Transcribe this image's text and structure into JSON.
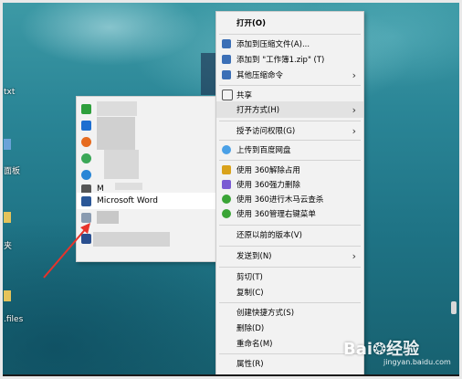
{
  "desktop": {
    "edge_labels": [
      "txt",
      "面板",
      "夹",
      ".files"
    ]
  },
  "submenu": {
    "items": [
      {
        "label": "",
        "icon": "edge-icon",
        "color": "#2e9f3c"
      },
      {
        "label": "",
        "icon": "app-icon",
        "color": "#1e6fd0"
      },
      {
        "label": "",
        "icon": "firefox-icon",
        "color": "#e66b1f"
      },
      {
        "label": "",
        "icon": "chrome-icon",
        "color": "#3aa757"
      },
      {
        "label": "",
        "icon": "ie-icon",
        "color": "#2a86d6"
      },
      {
        "label": "M",
        "icon": "app-icon",
        "color": "#555555"
      },
      {
        "label": "Microsoft Word",
        "icon": "word-icon",
        "color": "#2b5797"
      },
      {
        "label": "",
        "icon": "app-icon",
        "color": "#8a9bb0"
      },
      {
        "label": "",
        "icon": "app-icon",
        "color": "#2a4f8f"
      }
    ]
  },
  "context_menu": {
    "items": [
      {
        "label": "打开(O)",
        "bold": true
      },
      {
        "label": "添加到压缩文件(A)...",
        "icon": "archive-icon",
        "color": "#3b6fb6"
      },
      {
        "label": "添加到 \"工作簿1.zip\" (T)",
        "icon": "archive-icon",
        "color": "#3b6fb6"
      },
      {
        "label": "其他压缩命令",
        "icon": "archive-icon",
        "color": "#3b6fb6",
        "arrow": true
      },
      {
        "label": "共享",
        "icon": "share-icon",
        "color": "#555555"
      },
      {
        "label": "打开方式(H)",
        "arrow": true,
        "hover": true
      },
      {
        "label": "授予访问权限(G)",
        "arrow": true
      },
      {
        "label": "上传到百度网盘",
        "icon": "cloud-icon",
        "color": "#4aa0e6"
      },
      {
        "label": "使用 360解除占用",
        "icon": "unlock-icon",
        "color": "#d9a21b"
      },
      {
        "label": "使用 360强力删除",
        "icon": "delete-icon",
        "color": "#7a5bd3"
      },
      {
        "label": "使用 360进行木马云查杀",
        "icon": "shield-icon",
        "color": "#3aa436"
      },
      {
        "label": "使用 360管理右键菜单",
        "icon": "shield-icon",
        "color": "#3aa436"
      },
      {
        "label": "还原以前的版本(V)"
      },
      {
        "label": "发送到(N)",
        "arrow": true
      },
      {
        "label": "剪切(T)"
      },
      {
        "label": "复制(C)"
      },
      {
        "label": "创建快捷方式(S)"
      },
      {
        "label": "删除(D)"
      },
      {
        "label": "重命名(M)"
      },
      {
        "label": "属性(R)"
      }
    ],
    "arrow_glyph": "›"
  },
  "watermark": {
    "brand": "Bai",
    "brand2": "经验",
    "sub": "jingyan.baidu.com"
  },
  "accent": {
    "annotation_arrow": "#e8332b"
  }
}
